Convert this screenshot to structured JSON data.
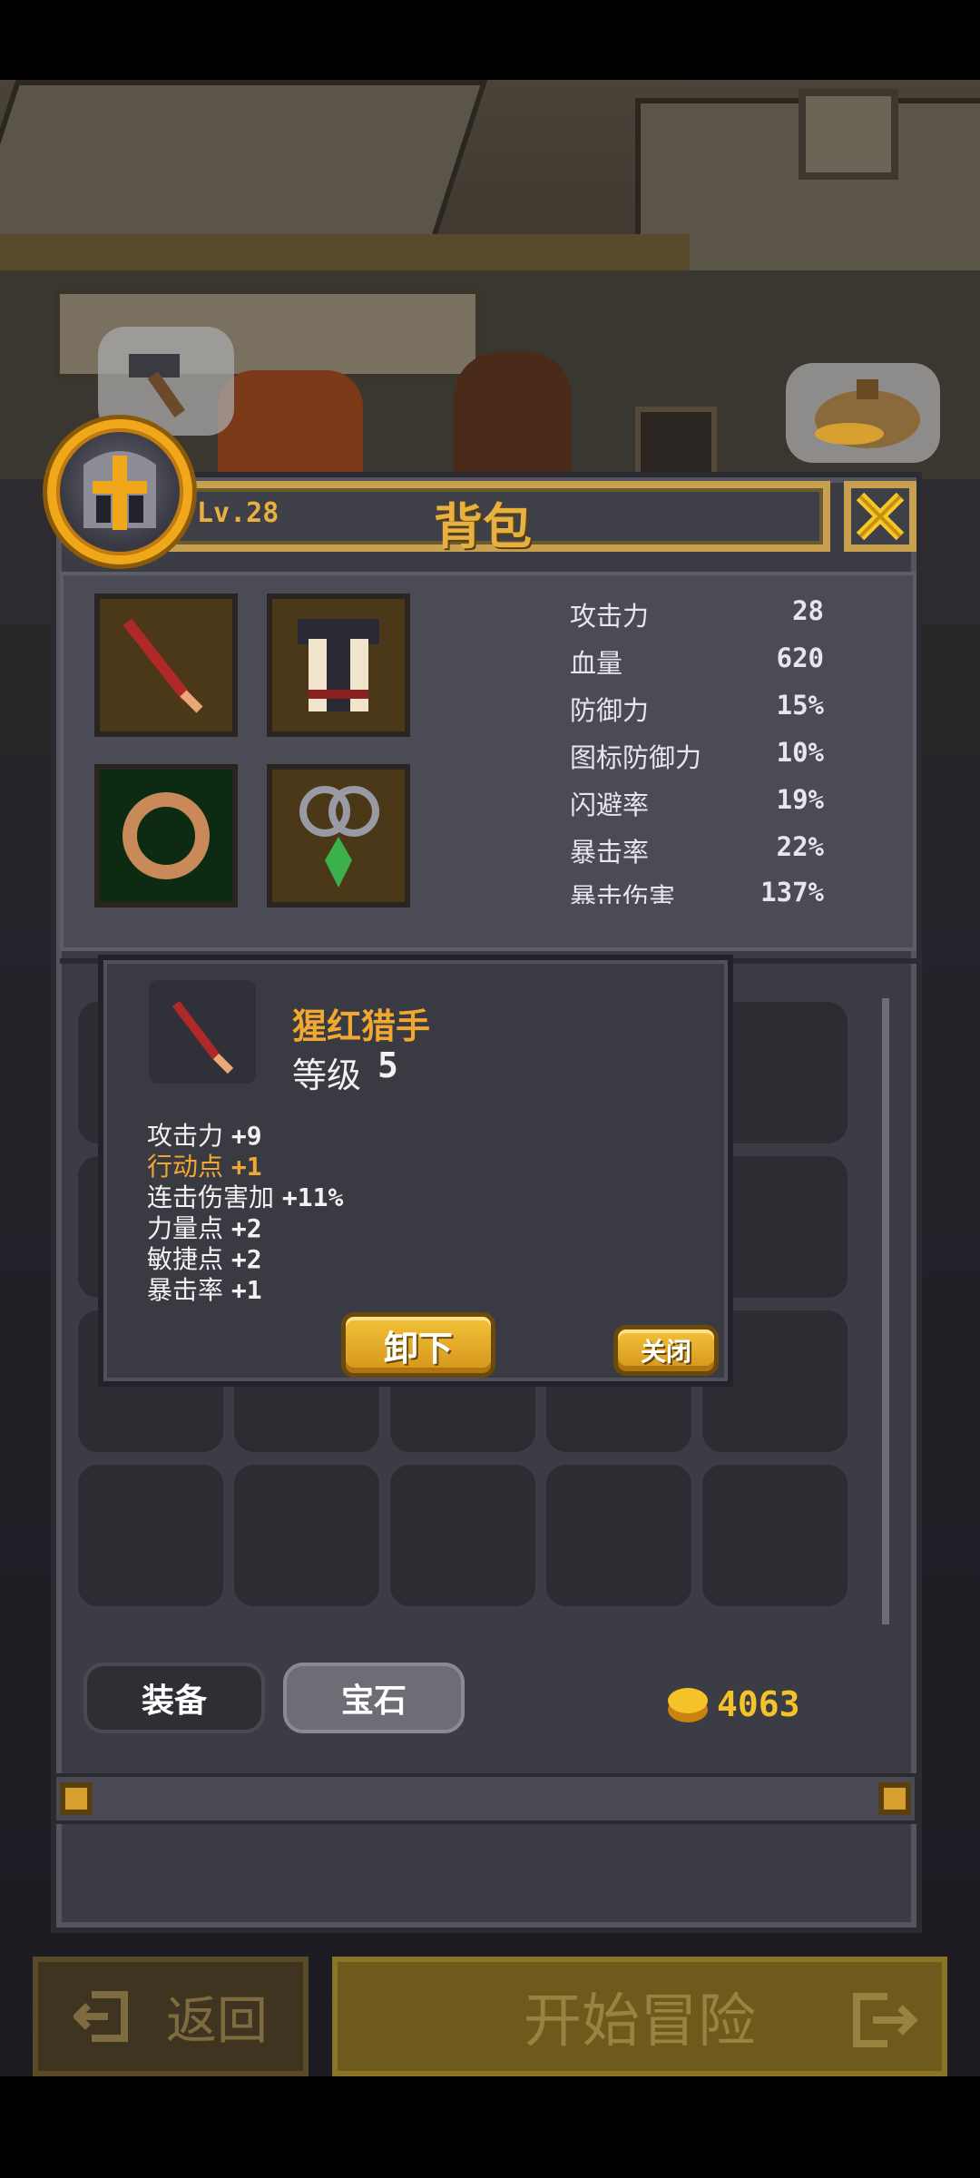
{
  "header": {
    "level": "Lv.28",
    "title": "背包"
  },
  "stats": [
    {
      "label": "攻击力",
      "value": "28"
    },
    {
      "label": "血量",
      "value": "620"
    },
    {
      "label": "防御力",
      "value": "15%"
    },
    {
      "label": "图标防御力",
      "value": "10%"
    },
    {
      "label": "闪避率",
      "value": "19%"
    },
    {
      "label": "暴击率",
      "value": "22%"
    },
    {
      "label": "暴击伤害",
      "value": "137%"
    }
  ],
  "equipment": [
    {
      "slot": "weapon",
      "icon": "red-dagger-icon"
    },
    {
      "slot": "armor",
      "icon": "leather-armor-icon"
    },
    {
      "slot": "ring",
      "icon": "bronze-ring-icon"
    },
    {
      "slot": "amulet",
      "icon": "green-gem-amulet-icon"
    }
  ],
  "tooltip": {
    "item_name": "猩红猎手",
    "level_label": "等级",
    "level_value": "5",
    "bonuses": [
      {
        "label": "攻击力",
        "value": "+9",
        "highlight": false
      },
      {
        "label": "行动点",
        "value": "+1",
        "highlight": true
      },
      {
        "label": "连击伤害加",
        "value": "+11%",
        "highlight": false
      },
      {
        "label": "力量点",
        "value": "+2",
        "highlight": false
      },
      {
        "label": "敏捷点",
        "value": "+2",
        "highlight": false
      },
      {
        "label": "暴击率",
        "value": "+1",
        "highlight": false
      }
    ],
    "unequip_label": "卸下",
    "close_label": "关闭"
  },
  "tabs": {
    "equipment": "装备",
    "gems": "宝石"
  },
  "gold": "4063",
  "footer": {
    "back_label": "返回",
    "start_label": "开始冒险"
  },
  "colors": {
    "accent_gold": "#f0a81a",
    "highlight_text": "#f0a830",
    "title_text": "#e8b040",
    "panel": "#3c3c44"
  }
}
